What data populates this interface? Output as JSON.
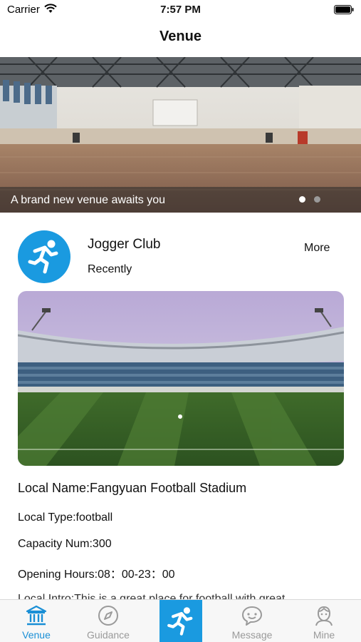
{
  "status_bar": {
    "carrier": "Carrier",
    "time": "7:57 PM"
  },
  "nav": {
    "title": "Venue"
  },
  "banner": {
    "caption": "A brand new venue awaits you",
    "page_count": 2,
    "active_page": 1
  },
  "club": {
    "name": "Jogger Club",
    "subtitle": "Recently",
    "more_label": "More",
    "logo_icon": "running-man-icon"
  },
  "venue": {
    "name": "Local Name:Fangyuan Football Stadium",
    "type": "Local Type:football",
    "capacity": "Capacity Num:300",
    "hours": "Opening Hours:08：00-23：00",
    "intro": "Local Intro:This is a great place for football with great"
  },
  "tab_bar": {
    "items": [
      {
        "label": "Venue",
        "icon": "temple-icon",
        "active": true
      },
      {
        "label": "Guidance",
        "icon": "compass-icon",
        "active": false
      },
      {
        "label": "",
        "icon": "running-man-icon",
        "active": false
      },
      {
        "label": "Message",
        "icon": "chat-bubble-icon",
        "active": false
      },
      {
        "label": "Mine",
        "icon": "user-face-icon",
        "active": false
      }
    ]
  },
  "colors": {
    "accent": "#1a9ae0",
    "tab_inactive": "#9a9a9a",
    "tab_active": "#1a8fd6"
  }
}
